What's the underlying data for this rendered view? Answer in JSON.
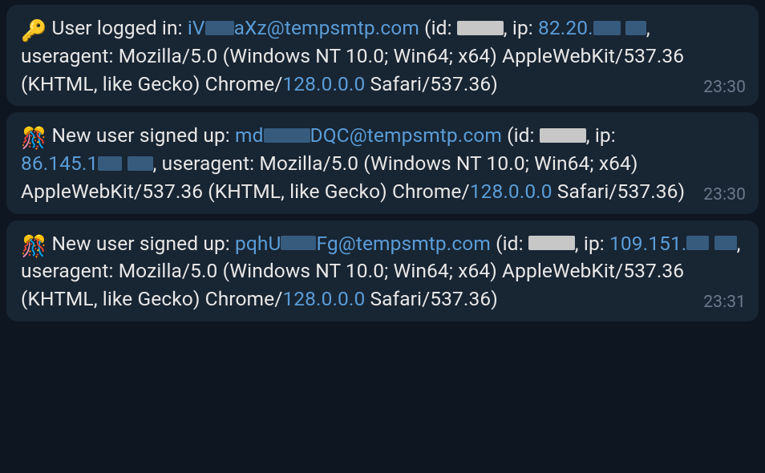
{
  "messages": [
    {
      "icon": "🔑",
      "prefix": "User logged in: ",
      "email_shown": "iV",
      "email_suffix": "aXz@tempsmtp.com",
      "id_label": " (id: ",
      "ip_label": ", ip: ",
      "ip_prefix": "82.20.",
      "after_ip": ", useragent: Mozilla/5.0 (Windows NT 10.0; Win64; x64) AppleWebKit/537.36 (KHTML, like Gecko) Chrome/",
      "chrome_ver": "128.0.0.0",
      "tail": " Safari/537.36)",
      "time": "23:30"
    },
    {
      "icon": "🎊",
      "prefix": "New user signed up: ",
      "email_shown": "md",
      "email_suffix": "DQC@tempsmtp.com",
      "id_label": " (id: ",
      "ip_label": ", ip: ",
      "ip_prefix": "86.145.1",
      "after_ip": ", useragent: Mozilla/5.0 (Windows NT 10.0; Win64; x64) AppleWebKit/537.36 (KHTML, like Gecko) Chrome/",
      "chrome_ver": "128.0.0.0",
      "tail": " Safari/537.36)",
      "time": "23:30"
    },
    {
      "icon": "🎊",
      "prefix": "New user signed up: ",
      "email_shown": "pqhU",
      "email_suffix": "Fg@tempsmtp.com",
      "id_label": " (id: ",
      "ip_label": ", ip: ",
      "ip_prefix": "109.151.",
      "after_ip": ", useragent: Mozilla/5.0 (Windows NT 10.0; Win64; x64) AppleWebKit/537.36 (KHTML, like Gecko) Chrome/",
      "chrome_ver": "128.0.0.0",
      "tail": " Safari/537.36)",
      "time": "23:31"
    }
  ]
}
